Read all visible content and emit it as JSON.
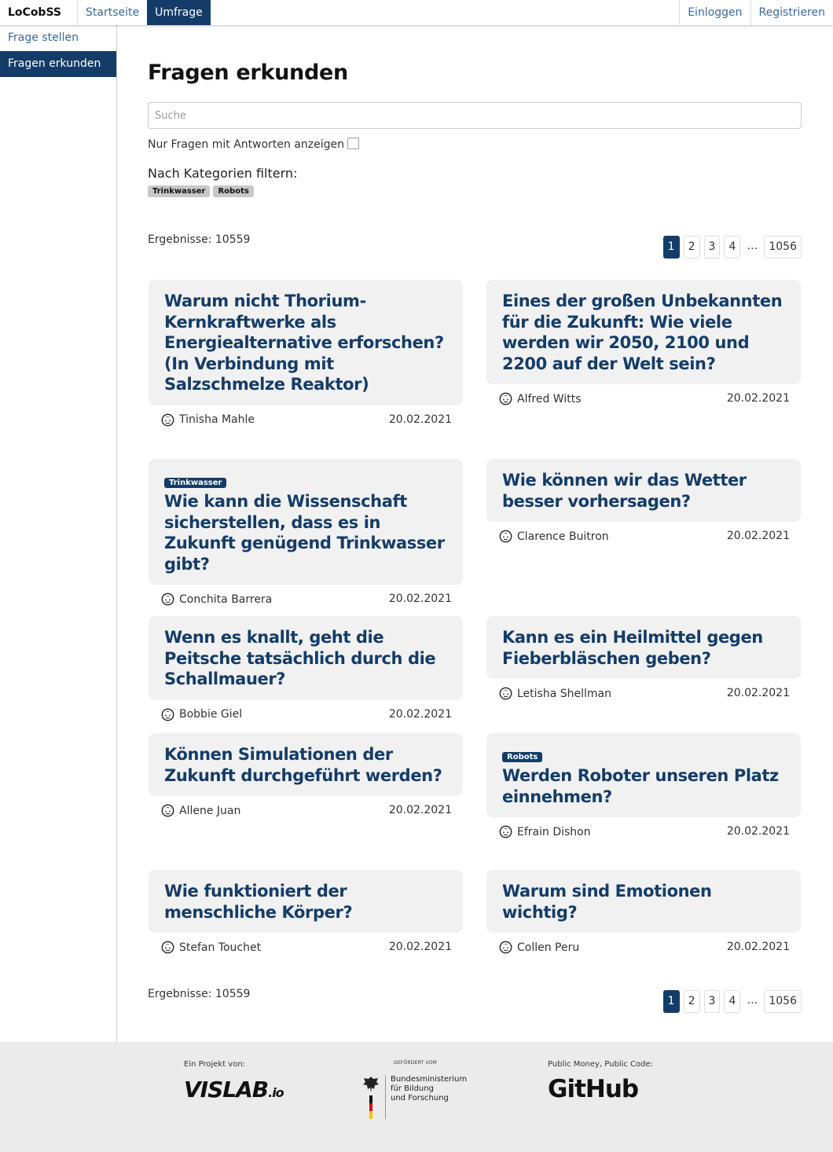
{
  "nav": {
    "brand": "LoCobSS",
    "links": [
      "Startseite",
      "Umfrage"
    ],
    "right": [
      "Einloggen",
      "Registrieren"
    ]
  },
  "sidebar": {
    "items": [
      "Frage stellen",
      "Fragen erkunden"
    ]
  },
  "main": {
    "title": "Fragen erkunden",
    "search_placeholder": "Suche",
    "only_answered_label": "Nur Fragen mit Antworten anzeigen",
    "category_label": "Nach Kategorien filtern:",
    "categories": [
      "Trinkwasser",
      "Robots"
    ],
    "results_label": "Ergebnisse: 10559",
    "pages": [
      "1",
      "2",
      "3",
      "4",
      "...",
      "1056"
    ]
  },
  "cards": [
    {
      "title": "Warum nicht Thorium-Kernkraftwerke als Energiealternative erforschen? (In Verbindung mit Salzschmelze Reaktor)",
      "tag": "",
      "author": "Tinisha Mahle",
      "date": "20.02.2021"
    },
    {
      "title": "Eines der großen Unbekannten für die Zukunft: Wie viele werden wir 2050, 2100 und 2200 auf der Welt sein?",
      "tag": "",
      "author": "Alfred Witts",
      "date": "20.02.2021"
    },
    {
      "title": "Wie kann die Wissenschaft sicherstellen, dass es in Zukunft genügend Trinkwasser gibt?",
      "tag": "Trinkwasser",
      "author": "Conchita Barrera",
      "date": "20.02.2021"
    },
    {
      "title": "Wie können wir das Wetter besser vorhersagen?",
      "tag": "",
      "author": "Clarence Buitron",
      "date": "20.02.2021"
    },
    {
      "title": "Wenn es knallt, geht die Peitsche tatsächlich durch die Schallmauer?",
      "tag": "",
      "author": "Bobbie Giel",
      "date": "20.02.2021"
    },
    {
      "title": "Kann es ein Heilmittel gegen Fieberbläschen geben?",
      "tag": "",
      "author": "Letisha Shellman",
      "date": "20.02.2021"
    },
    {
      "title": "Können Simulationen der Zukunft durchgeführt werden?",
      "tag": "",
      "author": "Allene Juan",
      "date": "20.02.2021"
    },
    {
      "title": "Werden Roboter unseren Platz einnehmen?",
      "tag": "Robots",
      "author": "Efrain Dishon",
      "date": "20.02.2021"
    },
    {
      "title": "Wie funktioniert der menschliche Körper?",
      "tag": "",
      "author": "Stefan Touchet",
      "date": "20.02.2021"
    },
    {
      "title": "Warum sind Emotionen wichtig?",
      "tag": "",
      "author": "Collen Peru",
      "date": "20.02.2021"
    }
  ],
  "footer": {
    "project_label": "Ein Projekt von:",
    "vislab_main": "VISLAB",
    "vislab_suffix": ".io",
    "funded_label": "GEFÖRDERT VOM",
    "bmbf_line1": "Bundesministerium",
    "bmbf_line2": "für Bildung",
    "bmbf_line3": "und Forschung",
    "code_label": "Public Money, Public Code:",
    "github": "GitHub"
  }
}
